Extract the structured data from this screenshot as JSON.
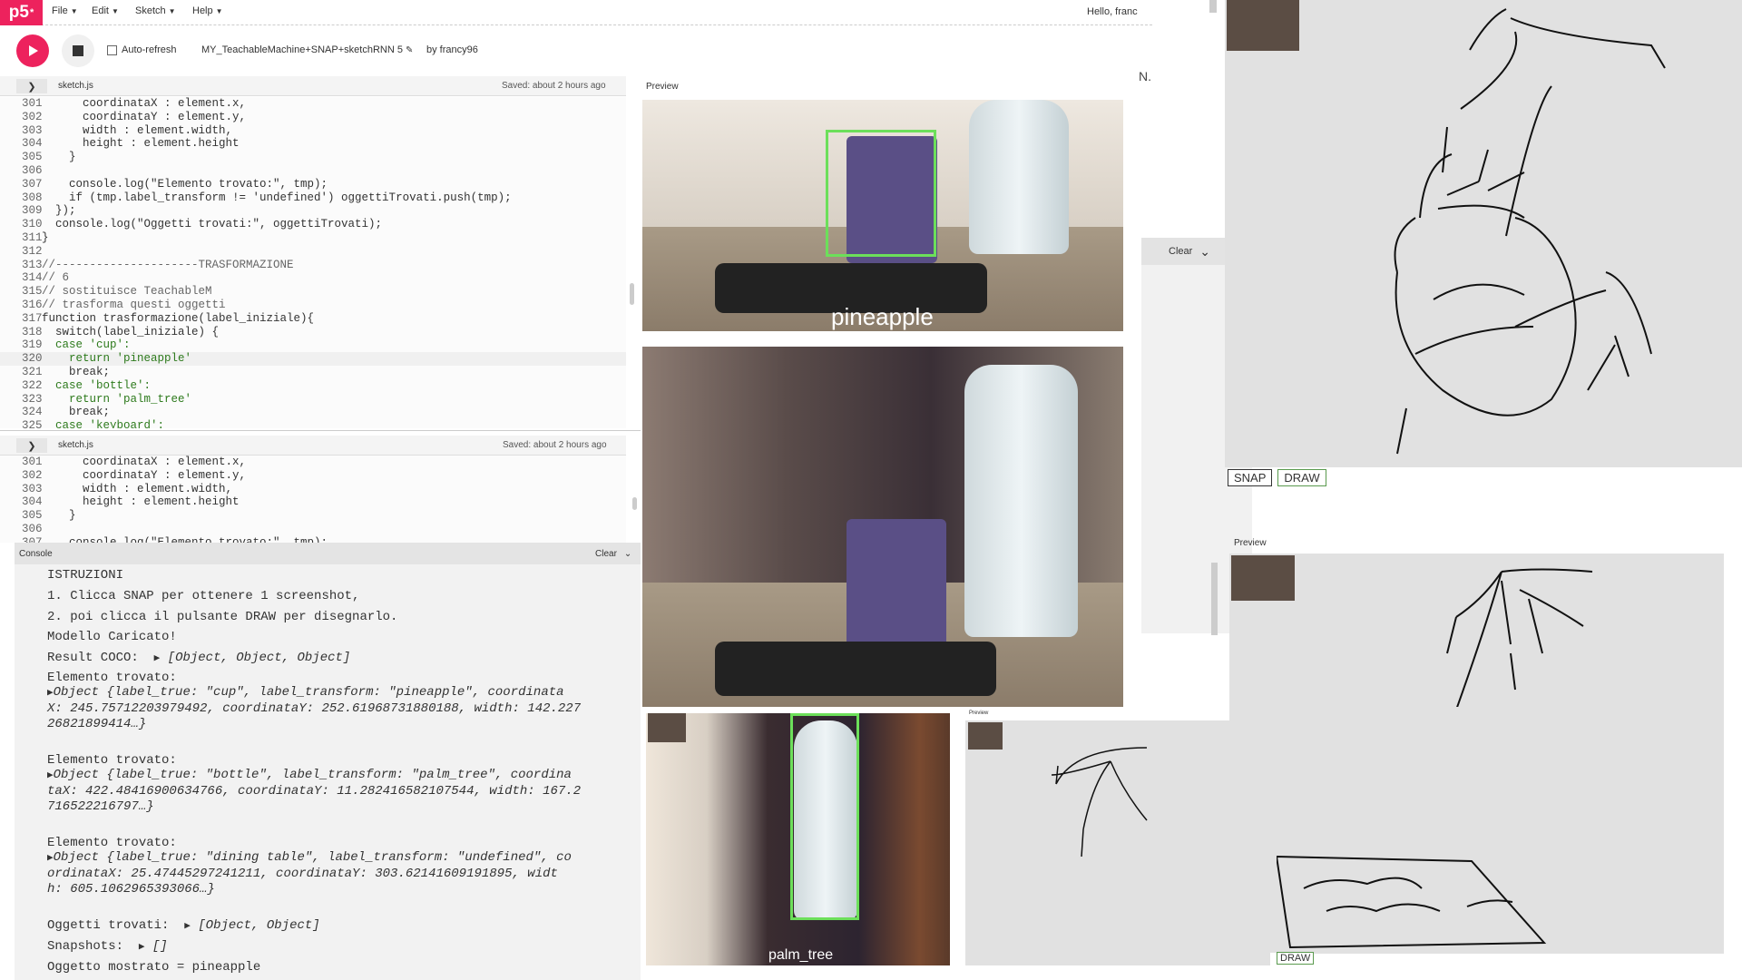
{
  "menubar": {
    "logo": "p5",
    "logo_sup": "*",
    "items": [
      {
        "label": "File"
      },
      {
        "label": "Edit"
      },
      {
        "label": "Sketch"
      },
      {
        "label": "Help"
      }
    ],
    "hello": "Hello, franc"
  },
  "toolbar": {
    "autorefresh_label": "Auto-refresh",
    "sketch_name": "MY_TeachableMachine+SNAP+sketchRNN 5",
    "by": "by francy96"
  },
  "editor_top": {
    "tab": "sketch.js",
    "saved": "Saved: about 2 hours ago",
    "lines": [
      {
        "n": "301",
        "t": "      coordinataX : element.x,"
      },
      {
        "n": "302",
        "t": "      coordinataY : element.y,"
      },
      {
        "n": "303",
        "t": "      width : element.width,"
      },
      {
        "n": "304",
        "t": "      height : element.height"
      },
      {
        "n": "305",
        "t": "    }"
      },
      {
        "n": "306",
        "t": ""
      },
      {
        "n": "307",
        "t": "    console.log(\"Elemento trovato:\", tmp);"
      },
      {
        "n": "308",
        "t": "    if (tmp.label_transform != 'undefined') oggettiTrovati.push(tmp);"
      },
      {
        "n": "309",
        "t": "  });"
      },
      {
        "n": "310",
        "t": "  console.log(\"Oggetti trovati:\", oggettiTrovati);"
      },
      {
        "n": "311",
        "t": "}"
      },
      {
        "n": "312",
        "t": ""
      },
      {
        "n": "313",
        "t": "//---------------------TRASFORMAZIONE"
      },
      {
        "n": "314",
        "t": "// 6"
      },
      {
        "n": "315",
        "t": "// sostituisce TeachableM"
      },
      {
        "n": "316",
        "t": "// trasforma questi oggetti"
      },
      {
        "n": "317",
        "t": "function trasformazione(label_iniziale){"
      },
      {
        "n": "318",
        "t": "  switch(label_iniziale) {"
      },
      {
        "n": "319",
        "t": "  case 'cup':"
      },
      {
        "n": "320",
        "t": "    return 'pineapple'"
      },
      {
        "n": "321",
        "t": "    break;"
      },
      {
        "n": "322",
        "t": "  case 'bottle':"
      },
      {
        "n": "323",
        "t": "    return 'palm_tree'"
      },
      {
        "n": "324",
        "t": "    break;"
      },
      {
        "n": "325",
        "t": "  case 'keyboard':"
      }
    ]
  },
  "editor_bottom": {
    "tab": "sketch.js",
    "saved": "Saved: about 2 hours ago",
    "lines": [
      {
        "n": "301",
        "t": "      coordinataX : element.x,"
      },
      {
        "n": "302",
        "t": "      coordinataY : element.y,"
      },
      {
        "n": "303",
        "t": "      width : element.width,"
      },
      {
        "n": "304",
        "t": "      height : element.height"
      },
      {
        "n": "305",
        "t": "    }"
      },
      {
        "n": "306",
        "t": ""
      },
      {
        "n": "307",
        "t": "    console.log(\"Elemento trovato:\", tmp);"
      }
    ]
  },
  "console": {
    "title": "Console",
    "clear": "Clear",
    "lines": [
      "ISTRUZIONI",
      "1. Clicca SNAP per ottenere 1 screenshot,",
      "2. poi clicca il pulsante DRAW per disegnarlo.",
      "Modello Caricato!",
      "Result COCO:",
      "[Object, Object, Object]",
      "Elemento trovato:",
      "Object {label_true: \"cup\", label_transform: \"pineapple\", coordinata",
      "X: 245.75712203979492, coordinataY: 252.61968731880188, width: 142.227",
      "26821899414…}",
      "Elemento trovato:",
      "Object {label_true: \"bottle\", label_transform: \"palm_tree\", coordina",
      "taX: 422.48416900634766, coordinataY: 11.282416582107544, width: 167.2",
      "716522216797…}",
      "Elemento trovato:",
      "Object {label_true: \"dining table\", label_transform: \"undefined\", co",
      "ordinataX: 25.47445297241211, coordinataY: 303.62141609191895, widt",
      "h: 605.1062965393066…}",
      "Oggetti trovati:",
      "[Object, Object]",
      "Snapshots:",
      "[]",
      "Oggetto mostrato = pineapple"
    ]
  },
  "preview": {
    "label": "Preview",
    "detections": [
      "pineapple",
      "palm_tree"
    ],
    "clear": "Clear",
    "buttons": {
      "snap": "SNAP",
      "draw": "DRAW"
    },
    "corner_letter": "N."
  },
  "colors": {
    "brand": "#ed225d",
    "bbox": "#6cdf5a"
  }
}
